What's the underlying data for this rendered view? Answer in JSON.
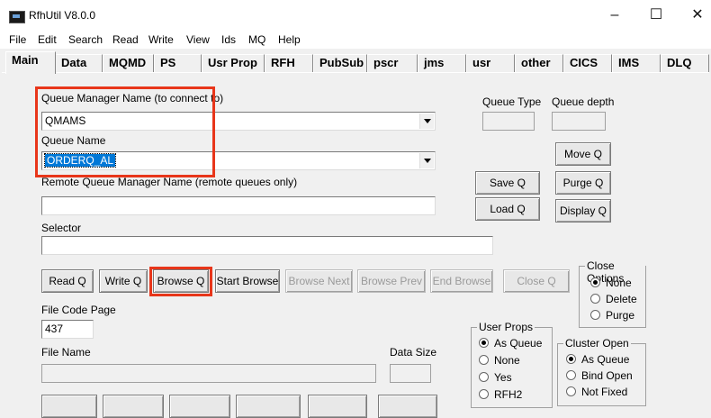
{
  "window": {
    "title": "RfhUtil V8.0.0",
    "minimize": "–",
    "maximize": "☐",
    "close": "✕"
  },
  "menu": [
    "File",
    "Edit",
    "Search",
    "Read",
    "Write",
    "View",
    "Ids",
    "MQ",
    "Help"
  ],
  "tabs": [
    "Main",
    "Data",
    "MQMD",
    "PS",
    "Usr Prop",
    "RFH",
    "PubSub",
    "pscr",
    "jms",
    "usr",
    "other",
    "CICS",
    "IMS",
    "DLQ"
  ],
  "main": {
    "qmgr_label": "Queue Manager Name (to connect to)",
    "qmgr_value": "QMAMS",
    "queue_label": "Queue Name",
    "queue_value": "ORDERQ_AL",
    "remote_qmgr_label": "Remote Queue Manager Name (remote queues only)",
    "remote_qmgr_value": "",
    "selector_label": "Selector",
    "selector_value": "",
    "queue_type_label": "Queue Type",
    "queue_depth_label": "Queue depth",
    "queue_type_value": "",
    "queue_depth_value": "",
    "file_code_page_label": "File Code Page",
    "file_code_page_value": "437",
    "file_name_label": "File Name",
    "file_name_value": "",
    "data_size_label": "Data Size",
    "data_size_value": ""
  },
  "buttons": {
    "move_q": "Move Q",
    "save_q": "Save Q",
    "purge_q": "Purge Q",
    "load_q": "Load Q",
    "display_q": "Display Q",
    "read_q": "Read Q",
    "write_q": "Write Q",
    "browse_q": "Browse Q",
    "start_browse": "Start Browse",
    "browse_next": "Browse Next",
    "browse_prev": "Browse Prev",
    "end_browse": "End Browse",
    "close_q": "Close Q"
  },
  "close_options": {
    "title": "Close Options",
    "options": [
      "None",
      "Delete",
      "Purge"
    ],
    "selected": 0
  },
  "user_props": {
    "title": "User Props",
    "options": [
      "As Queue",
      "None",
      "Yes",
      "RFH2"
    ],
    "selected": 0
  },
  "cluster_open": {
    "title": "Cluster Open",
    "options": [
      "As Queue",
      "Bind Open",
      "Not Fixed"
    ],
    "selected": 0
  },
  "highlight_color": "#e8361a"
}
